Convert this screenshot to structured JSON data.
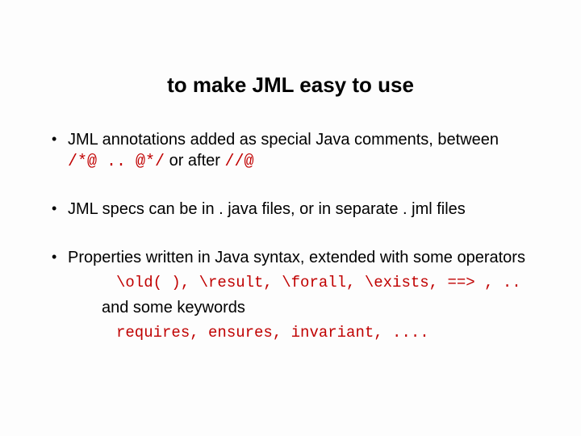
{
  "title": "to make JML easy to use",
  "bullets": [
    {
      "line1_a": "JML annotations added as special Java comments, between",
      "code1": "/*@ .. @*/",
      "line1_b": " or after ",
      "code2": "//@"
    },
    {
      "line1": "JML specs can be in . java files, or in separate . jml files"
    },
    {
      "line1": "Properties written in Java syntax, extended with some operators",
      "sub_code1": "\\old( ), \\result, \\forall, \\exists, ==> , ..",
      "line2": "and some keywords",
      "sub_code2": "requires, ensures, invariant, ...."
    }
  ]
}
